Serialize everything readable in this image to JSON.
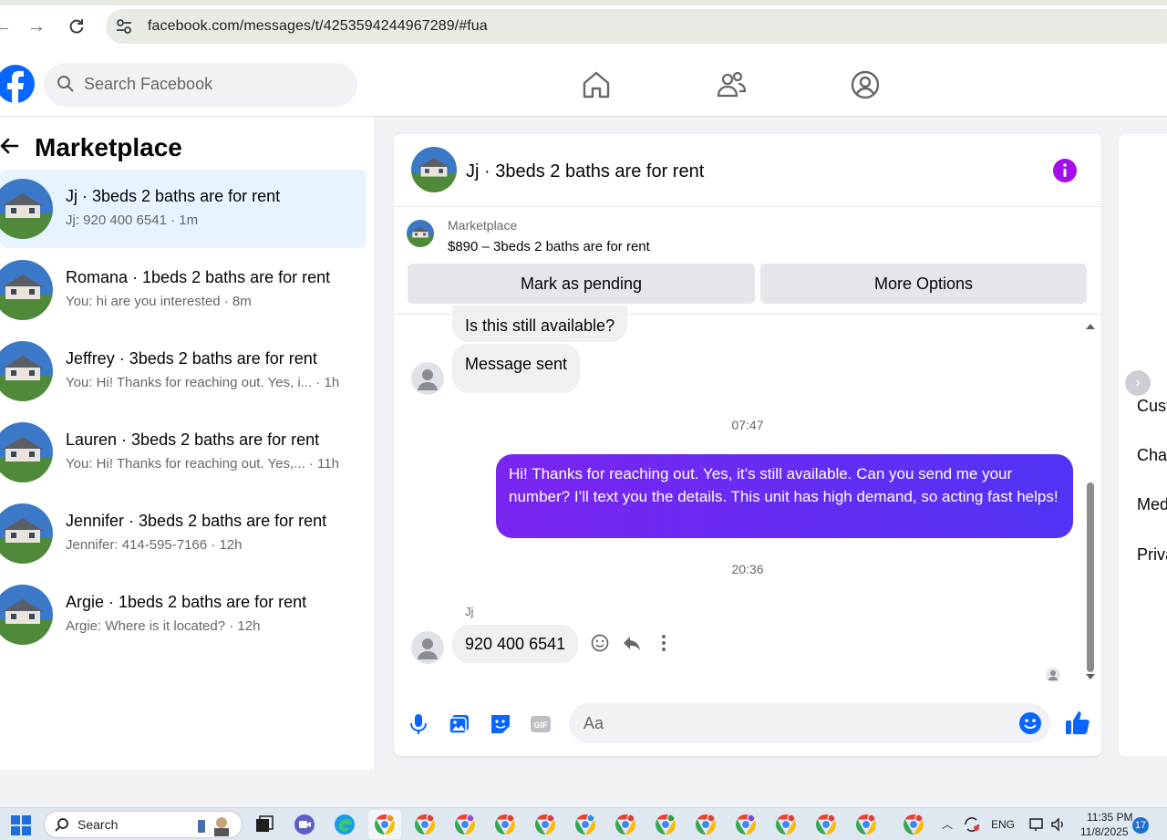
{
  "browser": {
    "url": "facebook.com/messages/t/4253594244967289/#fua"
  },
  "header": {
    "search_placeholder": "Search Facebook"
  },
  "sidebar": {
    "title": "Marketplace",
    "conversations": [
      {
        "title": "Jj · 3beds 2 baths are for rent",
        "preview": "Jj: 920 400 6541 · 1m",
        "active": true
      },
      {
        "title": "Romana · 1beds 2 baths are for rent",
        "preview": "You: hi are you interested · 8m",
        "active": false
      },
      {
        "title": "Jeffrey · 3beds 2 baths are for rent",
        "preview": "You: Hi! Thanks for reaching out. Yes, i... · 1h",
        "active": false
      },
      {
        "title": "Lauren · 3beds 2 baths are for rent",
        "preview": "You: Hi! Thanks for reaching out. Yes,... · 11h",
        "active": false
      },
      {
        "title": "Jennifer · 3beds 2 baths are for rent",
        "preview": "Jennifer: 414-595-7166 · 12h",
        "active": false
      },
      {
        "title": "Argie · 1beds 2 baths are for rent",
        "preview": "Argie: Where is it located? · 12h",
        "active": false
      }
    ]
  },
  "chat": {
    "title": "Jj · 3beds 2 baths are for rent",
    "listing": {
      "label": "Marketplace",
      "price_title": "$890 – 3beds 2 baths are for rent",
      "pending_button": "Mark as pending",
      "options_button": "More Options"
    },
    "messages": {
      "in_1": "Is this still available?",
      "in_2": "Message sent",
      "time_1": "07:47",
      "out_1": "Hi! Thanks for reaching out. Yes, it’s still available. Can you send me your number? I’ll text you the details. This unit has high demand, so acting fast helps!",
      "time_2": "20:36",
      "sender": "Jj",
      "in_3": "920 400 6541"
    },
    "composer_placeholder": "Aa"
  },
  "right_panel": {
    "links": [
      "Cust",
      "Chat",
      "Med",
      "Priva"
    ]
  },
  "taskbar": {
    "search_label": "Search",
    "language": "ENG",
    "time": "11:35 PM",
    "date": "11/8/2025",
    "notification_count": "17"
  },
  "colors": {
    "fb_blue": "#0866ff",
    "outgoing_gradient_start": "#7a25f0",
    "outgoing_gradient_end": "#5233f5",
    "active_convo": "#e7f3ff",
    "info_purple": "#a40ee8"
  }
}
